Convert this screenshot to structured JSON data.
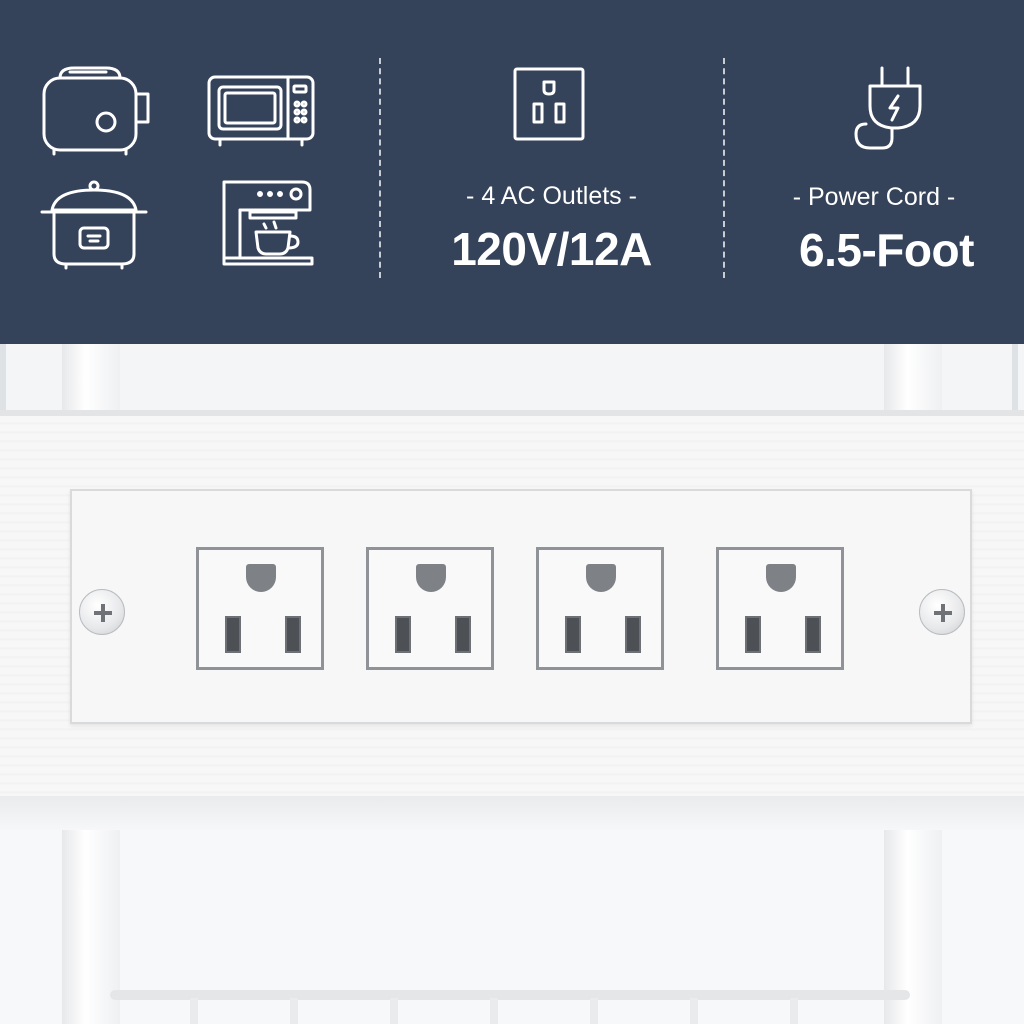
{
  "banner": {
    "background": "#34425a",
    "text_color": "#ffffff",
    "appliances": [
      {
        "icon": "toaster-icon"
      },
      {
        "icon": "microwave-icon"
      },
      {
        "icon": "rice-cooker-icon"
      },
      {
        "icon": "coffee-maker-icon"
      }
    ],
    "outlets_feature": {
      "icon": "outlet-icon",
      "caption": "- 4 AC Outlets -",
      "value": "120V/12A"
    },
    "cord_feature": {
      "icon": "power-plug-icon",
      "caption": "- Power Cord -",
      "value": "6.5-Foot"
    }
  },
  "photo": {
    "outlet_count": 4,
    "outlet_plate_color": "#f7f7f8"
  }
}
